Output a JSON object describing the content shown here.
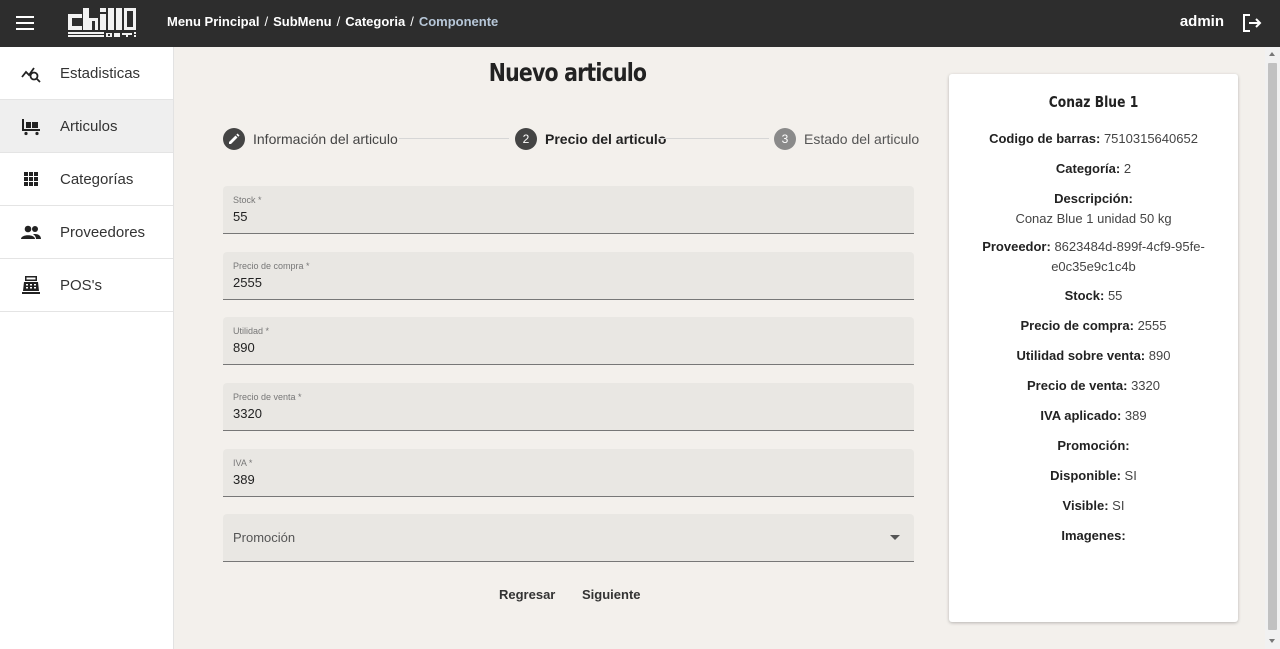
{
  "header": {
    "breadcrumb": [
      "Menu Principal",
      "SubMenu",
      "Categoria"
    ],
    "breadcrumb_current": "Componente",
    "user": "admin",
    "logo_text": "Chill OUT"
  },
  "sidebar": {
    "items": [
      {
        "label": "Estadisticas",
        "icon": "stats-icon"
      },
      {
        "label": "Articulos",
        "icon": "cart-icon",
        "active": true
      },
      {
        "label": "Categorías",
        "icon": "grid-icon"
      },
      {
        "label": "Proveedores",
        "icon": "people-icon"
      },
      {
        "label": "POS's",
        "icon": "register-icon"
      }
    ]
  },
  "form": {
    "title": "Nuevo articulo",
    "steps": [
      {
        "number": "1",
        "label": "Información del articulo",
        "state": "done"
      },
      {
        "number": "2",
        "label": "Precio del articulo",
        "state": "active"
      },
      {
        "number": "3",
        "label": "Estado del articulo",
        "state": "pending"
      }
    ],
    "fields": [
      {
        "label": "Stock *",
        "value": "55"
      },
      {
        "label": "Precio de compra *",
        "value": "2555"
      },
      {
        "label": "Utilidad *",
        "value": "890"
      },
      {
        "label": "Precio de venta *",
        "value": "3320"
      },
      {
        "label": "IVA *",
        "value": "389"
      }
    ],
    "promo_placeholder": "Promoción",
    "back_label": "Regresar",
    "next_label": "Siguiente"
  },
  "summary": {
    "title": "Conaz Blue 1",
    "rows": [
      {
        "label": "Codigo de barras:",
        "value": "7510315640652"
      },
      {
        "label": "Categoría:",
        "value": "2"
      },
      {
        "label": "Descripción:",
        "value": "Conaz Blue 1 unidad 50 kg"
      },
      {
        "label": "Proveedor:",
        "value": "8623484d-899f-4cf9-95fe-e0c35e9c1c4b"
      },
      {
        "label": "Stock:",
        "value": "55"
      },
      {
        "label": "Precio de compra:",
        "value": "2555"
      },
      {
        "label": "Utilidad sobre venta:",
        "value": "890"
      },
      {
        "label": "Precio de venta:",
        "value": "3320"
      },
      {
        "label": "IVA aplicado:",
        "value": "389"
      },
      {
        "label": "Promoción:",
        "value": ""
      },
      {
        "label": "Disponible:",
        "value": "SI"
      },
      {
        "label": "Visible:",
        "value": "SI"
      },
      {
        "label": "Imagenes:",
        "value": ""
      }
    ]
  },
  "colors": {
    "topbar": "#2d2d2d",
    "background": "#f3f0ec",
    "step_done": "#444444",
    "step_active": "#444444",
    "step_pending": "#8a8a8a",
    "breadcrumb_current": "#b7c7d8"
  }
}
